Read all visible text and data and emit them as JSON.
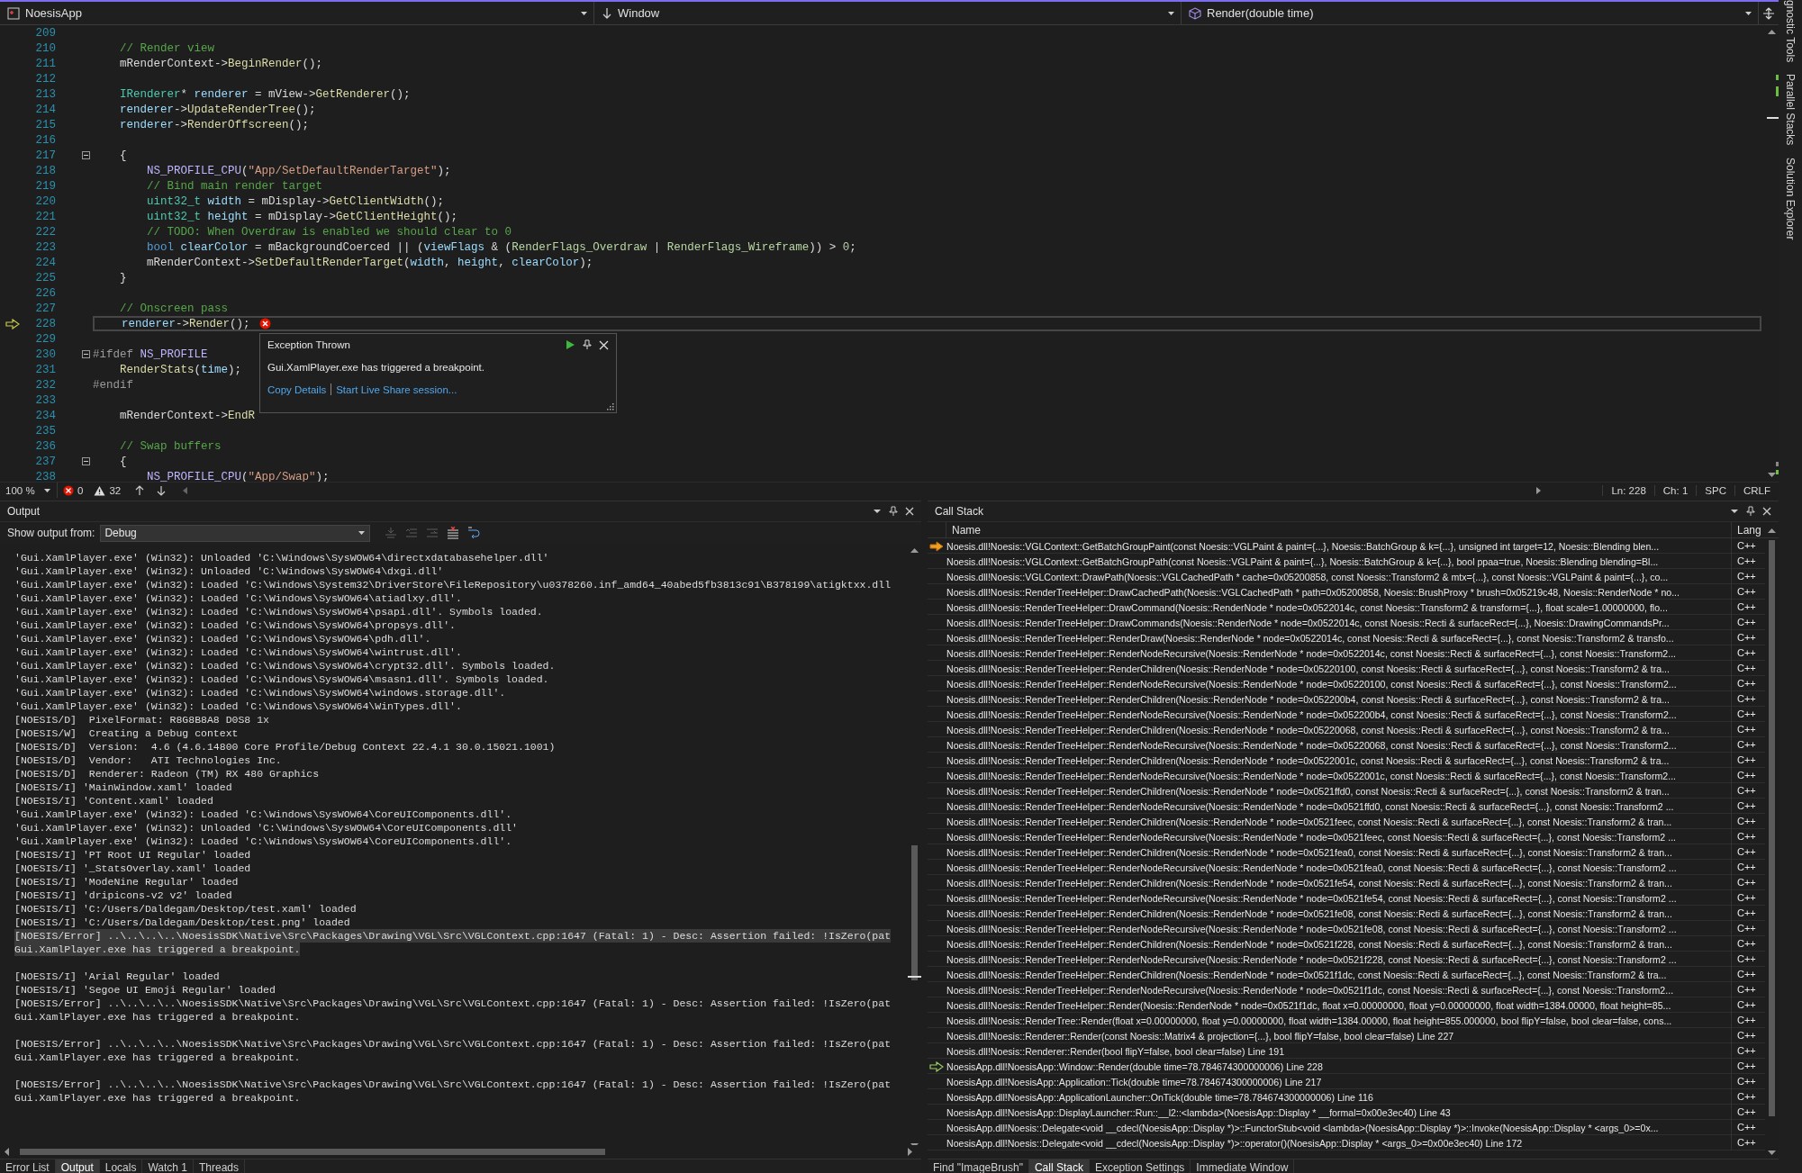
{
  "navigation_bar": [
    {
      "kind": "project",
      "label": "NoesisApp"
    },
    {
      "kind": "scope",
      "label": "Window"
    },
    {
      "kind": "member",
      "label": "Render(double time)"
    }
  ],
  "editor": {
    "lines": [
      {
        "number": "209",
        "current": false
      },
      {
        "number": "210",
        "current": false,
        "code": [
          {
            "kind": "comment",
            "text": "    // Render view"
          }
        ]
      },
      {
        "number": "211",
        "current": false,
        "code": [
          {
            "kind": "plain",
            "text": "    mRenderContext->"
          },
          {
            "kind": "func",
            "text": "BeginRender"
          },
          {
            "kind": "plain",
            "text": "();"
          }
        ]
      },
      {
        "number": "212",
        "current": false
      },
      {
        "number": "213",
        "current": false,
        "code": [
          {
            "kind": "type",
            "text": "    IRenderer"
          },
          {
            "kind": "plain",
            "text": "* "
          },
          {
            "kind": "var",
            "text": "renderer"
          },
          {
            "kind": "plain",
            "text": " = mView->"
          },
          {
            "kind": "func",
            "text": "GetRenderer"
          },
          {
            "kind": "plain",
            "text": "();"
          }
        ]
      },
      {
        "number": "214",
        "current": false,
        "code": [
          {
            "kind": "var",
            "text": "    renderer"
          },
          {
            "kind": "plain",
            "text": "->"
          },
          {
            "kind": "func",
            "text": "UpdateRenderTree"
          },
          {
            "kind": "plain",
            "text": "();"
          }
        ]
      },
      {
        "number": "215",
        "current": false,
        "code": [
          {
            "kind": "var",
            "text": "    renderer"
          },
          {
            "kind": "plain",
            "text": "->"
          },
          {
            "kind": "func",
            "text": "RenderOffscreen"
          },
          {
            "kind": "plain",
            "text": "();"
          }
        ]
      },
      {
        "number": "216",
        "current": false
      },
      {
        "number": "217",
        "current": false,
        "expanded": true,
        "code": [
          {
            "kind": "plain",
            "text": "    {"
          }
        ]
      },
      {
        "number": "218",
        "current": false,
        "code": [
          {
            "kind": "macro",
            "text": "        NS_PROFILE_CPU"
          },
          {
            "kind": "plain",
            "text": "("
          },
          {
            "kind": "string",
            "text": "\"App/SetDefaultRenderTarget\""
          },
          {
            "kind": "plain",
            "text": ");"
          }
        ]
      },
      {
        "number": "219",
        "current": false,
        "code": [
          {
            "kind": "comment",
            "text": "        // Bind main render target"
          }
        ]
      },
      {
        "number": "220",
        "current": false,
        "code": [
          {
            "kind": "type",
            "text": "        uint32_t "
          },
          {
            "kind": "var",
            "text": "width"
          },
          {
            "kind": "plain",
            "text": " = mDisplay->"
          },
          {
            "kind": "func",
            "text": "GetClientWidth"
          },
          {
            "kind": "plain",
            "text": "();"
          }
        ]
      },
      {
        "number": "221",
        "current": false,
        "code": [
          {
            "kind": "type",
            "text": "        uint32_t "
          },
          {
            "kind": "var",
            "text": "height"
          },
          {
            "kind": "plain",
            "text": " = mDisplay->"
          },
          {
            "kind": "func",
            "text": "GetClientHeight"
          },
          {
            "kind": "plain",
            "text": "();"
          }
        ]
      },
      {
        "number": "222",
        "current": false,
        "code": [
          {
            "kind": "comment",
            "text": "        // TODO: When Overdraw is enabled we should clear to 0"
          }
        ]
      },
      {
        "number": "223",
        "current": false,
        "code": [
          {
            "kind": "keyword",
            "text": "        bool "
          },
          {
            "kind": "var",
            "text": "clearColor"
          },
          {
            "kind": "plain",
            "text": " = mBackgroundCoerced || ("
          },
          {
            "kind": "var",
            "text": "viewFlags"
          },
          {
            "kind": "plain",
            "text": " & ("
          },
          {
            "kind": "enum",
            "text": "RenderFlags_Overdraw"
          },
          {
            "kind": "plain",
            "text": " | "
          },
          {
            "kind": "enum",
            "text": "RenderFlags_Wireframe"
          },
          {
            "kind": "plain",
            "text": ")) > "
          },
          {
            "kind": "number",
            "text": "0"
          },
          {
            "kind": "plain",
            "text": ";"
          }
        ]
      },
      {
        "number": "224",
        "current": false,
        "code": [
          {
            "kind": "plain",
            "text": "        mRenderContext->"
          },
          {
            "kind": "func",
            "text": "SetDefaultRenderTarget"
          },
          {
            "kind": "plain",
            "text": "("
          },
          {
            "kind": "var",
            "text": "width"
          },
          {
            "kind": "plain",
            "text": ", "
          },
          {
            "kind": "var",
            "text": "height"
          },
          {
            "kind": "plain",
            "text": ", "
          },
          {
            "kind": "var",
            "text": "clearColor"
          },
          {
            "kind": "plain",
            "text": ");"
          }
        ]
      },
      {
        "number": "225",
        "current": false,
        "code": [
          {
            "kind": "plain",
            "text": "    }"
          }
        ]
      },
      {
        "number": "226",
        "current": false
      },
      {
        "number": "227",
        "current": false,
        "code": [
          {
            "kind": "comment",
            "text": "    // Onscreen pass"
          }
        ]
      },
      {
        "number": "228",
        "current": true,
        "kind": "error",
        "code": [
          {
            "kind": "var",
            "text": "    renderer"
          },
          {
            "kind": "plain",
            "text": "->"
          },
          {
            "kind": "func",
            "text": "Render"
          },
          {
            "kind": "plain",
            "text": "();"
          }
        ]
      },
      {
        "number": "229",
        "current": false
      },
      {
        "number": "230",
        "current": false,
        "expanded": true,
        "code": [
          {
            "kind": "preproc",
            "text": "#ifdef "
          },
          {
            "kind": "macro",
            "text": "NS_PROFILE"
          }
        ]
      },
      {
        "number": "231",
        "current": false,
        "code": [
          {
            "kind": "func",
            "text": "    RenderStats"
          },
          {
            "kind": "plain",
            "text": "("
          },
          {
            "kind": "var",
            "text": "time"
          },
          {
            "kind": "plain",
            "text": ");"
          }
        ]
      },
      {
        "number": "232",
        "current": false,
        "code": [
          {
            "kind": "preproc",
            "text": "#endif"
          }
        ]
      },
      {
        "number": "233",
        "current": false
      },
      {
        "number": "234",
        "current": false,
        "code": [
          {
            "kind": "plain",
            "text": "    mRenderContext->"
          },
          {
            "kind": "func",
            "text": "EndR"
          }
        ]
      },
      {
        "number": "235",
        "current": false
      },
      {
        "number": "236",
        "current": false,
        "code": [
          {
            "kind": "comment",
            "text": "    // Swap buffers"
          }
        ]
      },
      {
        "number": "237",
        "current": false,
        "expanded": true,
        "code": [
          {
            "kind": "plain",
            "text": "    {"
          }
        ]
      },
      {
        "number": "238",
        "current": false,
        "code": [
          {
            "kind": "macro",
            "text": "        NS_PROFILE_CPU"
          },
          {
            "kind": "plain",
            "text": "("
          },
          {
            "kind": "string",
            "text": "\"App/Swap\""
          },
          {
            "kind": "plain",
            "text": ");"
          }
        ]
      }
    ],
    "exception_popup": {
      "title": "Exception Thrown",
      "message": "Gui.XamlPlayer.exe has triggered a breakpoint.",
      "links": [
        "Copy Details",
        "Start Live Share session..."
      ]
    },
    "status": {
      "zoom": "100 %",
      "errors": "0",
      "warnings": "32",
      "line": "Ln: 228",
      "column": "Ch: 1",
      "whitespace": "SPC",
      "line_ending": "CRLF"
    }
  },
  "output": {
    "title": "Output",
    "source_label": "Show output from:",
    "source": "Debug",
    "toolbar": [
      {
        "kind": "find",
        "disabled": true
      },
      {
        "kind": "prev",
        "disabled": true
      },
      {
        "kind": "next",
        "disabled": true
      },
      {
        "kind": "clear",
        "disabled": false
      },
      {
        "kind": "wrap",
        "disabled": false
      }
    ],
    "lines": [
      {
        "text": "'Gui.XamlPlayer.exe' (Win32): Unloaded 'C:\\Windows\\SysWOW64\\directxdatabasehelper.dll'",
        "selected": false
      },
      {
        "text": "'Gui.XamlPlayer.exe' (Win32): Unloaded 'C:\\Windows\\SysWOW64\\dxgi.dll'",
        "selected": false
      },
      {
        "text": "'Gui.XamlPlayer.exe' (Win32): Loaded 'C:\\Windows\\System32\\DriverStore\\FileRepository\\u0378260.inf_amd64_40abed5fb3813c91\\B378199\\atigktxx.dll",
        "selected": false
      },
      {
        "text": "'Gui.XamlPlayer.exe' (Win32): Loaded 'C:\\Windows\\SysWOW64\\atiadlxy.dll'.",
        "selected": false
      },
      {
        "text": "'Gui.XamlPlayer.exe' (Win32): Loaded 'C:\\Windows\\SysWOW64\\psapi.dll'. Symbols loaded.",
        "selected": false
      },
      {
        "text": "'Gui.XamlPlayer.exe' (Win32): Loaded 'C:\\Windows\\SysWOW64\\propsys.dll'.",
        "selected": false
      },
      {
        "text": "'Gui.XamlPlayer.exe' (Win32): Loaded 'C:\\Windows\\SysWOW64\\pdh.dll'.",
        "selected": false
      },
      {
        "text": "'Gui.XamlPlayer.exe' (Win32): Loaded 'C:\\Windows\\SysWOW64\\wintrust.dll'.",
        "selected": false
      },
      {
        "text": "'Gui.XamlPlayer.exe' (Win32): Loaded 'C:\\Windows\\SysWOW64\\crypt32.dll'. Symbols loaded.",
        "selected": false
      },
      {
        "text": "'Gui.XamlPlayer.exe' (Win32): Loaded 'C:\\Windows\\SysWOW64\\msasn1.dll'. Symbols loaded.",
        "selected": false
      },
      {
        "text": "'Gui.XamlPlayer.exe' (Win32): Loaded 'C:\\Windows\\SysWOW64\\windows.storage.dll'.",
        "selected": false
      },
      {
        "text": "'Gui.XamlPlayer.exe' (Win32): Loaded 'C:\\Windows\\SysWOW64\\WinTypes.dll'.",
        "selected": false
      },
      {
        "text": "[NOESIS/D]  PixelFormat: R8G8B8A8 D0S8 1x",
        "selected": false
      },
      {
        "text": "[NOESIS/W]  Creating a Debug context",
        "selected": false
      },
      {
        "text": "[NOESIS/D]  Version:  4.6 (4.6.14800 Core Profile/Debug Context 22.4.1 30.0.15021.1001)",
        "selected": false
      },
      {
        "text": "[NOESIS/D]  Vendor:   ATI Technologies Inc.",
        "selected": false
      },
      {
        "text": "[NOESIS/D]  Renderer: Radeon (TM) RX 480 Graphics",
        "selected": false
      },
      {
        "text": "[NOESIS/I] 'MainWindow.xaml' loaded",
        "selected": false
      },
      {
        "text": "[NOESIS/I] 'Content.xaml' loaded",
        "selected": false
      },
      {
        "text": "'Gui.XamlPlayer.exe' (Win32): Loaded 'C:\\Windows\\SysWOW64\\CoreUIComponents.dll'.",
        "selected": false
      },
      {
        "text": "'Gui.XamlPlayer.exe' (Win32): Unloaded 'C:\\Windows\\SysWOW64\\CoreUIComponents.dll'",
        "selected": false
      },
      {
        "text": "'Gui.XamlPlayer.exe' (Win32): Loaded 'C:\\Windows\\SysWOW64\\CoreUIComponents.dll'.",
        "selected": false
      },
      {
        "text": "[NOESIS/I] 'PT Root UI Regular' loaded",
        "selected": false
      },
      {
        "text": "[NOESIS/I] '_StatsOverlay.xaml' loaded",
        "selected": false
      },
      {
        "text": "[NOESIS/I] 'ModeNine Regular' loaded",
        "selected": false
      },
      {
        "text": "[NOESIS/I] 'dripicons-v2 v2' loaded",
        "selected": false
      },
      {
        "text": "[NOESIS/I] 'C:/Users/Daldegam/Desktop/test.xaml' loaded",
        "selected": false
      },
      {
        "text": "[NOESIS/I] 'C:/Users/Daldegam/Desktop/test.png' loaded",
        "selected": false
      },
      {
        "text": "[NOESIS/Error] ..\\..\\..\\..\\NoesisSDK\\Native\\Src\\Packages\\Drawing\\VGL\\Src\\VGLContext.cpp:1647 (Fatal: 1) - Desc: Assertion failed: !IsZero(pat",
        "selected": true
      },
      {
        "text": "Gui.XamlPlayer.exe has triggered a breakpoint.",
        "selected": true
      },
      {
        "kind": "blank",
        "selected": false
      },
      {
        "text": "[NOESIS/I] 'Arial Regular' loaded",
        "selected": false
      },
      {
        "text": "[NOESIS/I] 'Segoe UI Emoji Regular' loaded",
        "selected": false
      },
      {
        "text": "[NOESIS/Error] ..\\..\\..\\..\\NoesisSDK\\Native\\Src\\Packages\\Drawing\\VGL\\Src\\VGLContext.cpp:1647 (Fatal: 1) - Desc: Assertion failed: !IsZero(pat",
        "selected": false
      },
      {
        "text": "Gui.XamlPlayer.exe has triggered a breakpoint.",
        "selected": false
      },
      {
        "kind": "blank",
        "selected": false
      },
      {
        "text": "[NOESIS/Error] ..\\..\\..\\..\\NoesisSDK\\Native\\Src\\Packages\\Drawing\\VGL\\Src\\VGLContext.cpp:1647 (Fatal: 1) - Desc: Assertion failed: !IsZero(pat",
        "selected": false
      },
      {
        "text": "Gui.XamlPlayer.exe has triggered a breakpoint.",
        "selected": false
      },
      {
        "kind": "blank",
        "selected": false
      },
      {
        "text": "[NOESIS/Error] ..\\..\\..\\..\\NoesisSDK\\Native\\Src\\Packages\\Drawing\\VGL\\Src\\VGLContext.cpp:1647 (Fatal: 1) - Desc: Assertion failed: !IsZero(pat",
        "selected": false
      },
      {
        "text": "Gui.XamlPlayer.exe has triggered a breakpoint.",
        "selected": false
      }
    ],
    "tabs": [
      {
        "label": "Error List",
        "selected": false
      },
      {
        "label": "Output",
        "selected": true
      },
      {
        "label": "Locals",
        "selected": false
      },
      {
        "label": "Watch 1",
        "selected": false
      },
      {
        "label": "Threads",
        "selected": false
      }
    ]
  },
  "call_stack": {
    "title": "Call Stack",
    "columns": [
      "Name",
      "Lang"
    ],
    "rows": [
      {
        "name": "Noesis.dll!Noesis::VGLContext::GetBatchGroupPaint(const Noesis::VGLPaint & paint={...}, Noesis::BatchGroup & k={...}, unsigned int target=12, Noesis::Blending blen...",
        "lang": "C++",
        "kind": "current"
      },
      {
        "name": "Noesis.dll!Noesis::VGLContext::GetBatchGroupPath(const Noesis::VGLPaint & paint={...}, Noesis::BatchGroup & k={...}, bool ppaa=true, Noesis::Blending blending=Bl...",
        "lang": "C++"
      },
      {
        "name": "Noesis.dll!Noesis::VGLContext::DrawPath(Noesis::VGLCachedPath * cache=0x05200858, const Noesis::Transform2 & mtx={...}, const Noesis::VGLPaint & paint={...}, co...",
        "lang": "C++"
      },
      {
        "name": "Noesis.dll!Noesis::RenderTreeHelper::DrawCachedPath(Noesis::VGLCachedPath * path=0x05200858, Noesis::BrushProxy * brush=0x05219c48, Noesis::RenderNode * no...",
        "lang": "C++"
      },
      {
        "name": "Noesis.dll!Noesis::RenderTreeHelper::DrawCommand(Noesis::RenderNode * node=0x0522014c, const Noesis::Transform2 & transform={...}, float scale=1.00000000, flo...",
        "lang": "C++"
      },
      {
        "name": "Noesis.dll!Noesis::RenderTreeHelper::DrawCommands(Noesis::RenderNode * node=0x0522014c, const Noesis::Recti & surfaceRect={...}, Noesis::DrawingCommandsPr...",
        "lang": "C++"
      },
      {
        "name": "Noesis.dll!Noesis::RenderTreeHelper::RenderDraw(Noesis::RenderNode * node=0x0522014c, const Noesis::Recti & surfaceRect={...}, const Noesis::Transform2 & transfo...",
        "lang": "C++"
      },
      {
        "name": "Noesis.dll!Noesis::RenderTreeHelper::RenderNodeRecursive(Noesis::RenderNode * node=0x0522014c, const Noesis::Recti & surfaceRect={...}, const Noesis::Transform2...",
        "lang": "C++"
      },
      {
        "name": "Noesis.dll!Noesis::RenderTreeHelper::RenderChildren(Noesis::RenderNode * node=0x05220100, const Noesis::Recti & surfaceRect={...}, const Noesis::Transform2 & tra...",
        "lang": "C++"
      },
      {
        "name": "Noesis.dll!Noesis::RenderTreeHelper::RenderNodeRecursive(Noesis::RenderNode * node=0x05220100, const Noesis::Recti & surfaceRect={...}, const Noesis::Transform2...",
        "lang": "C++"
      },
      {
        "name": "Noesis.dll!Noesis::RenderTreeHelper::RenderChildren(Noesis::RenderNode * node=0x052200b4, const Noesis::Recti & surfaceRect={...}, const Noesis::Transform2 & tra...",
        "lang": "C++"
      },
      {
        "name": "Noesis.dll!Noesis::RenderTreeHelper::RenderNodeRecursive(Noesis::RenderNode * node=0x052200b4, const Noesis::Recti & surfaceRect={...}, const Noesis::Transform2...",
        "lang": "C++"
      },
      {
        "name": "Noesis.dll!Noesis::RenderTreeHelper::RenderChildren(Noesis::RenderNode * node=0x05220068, const Noesis::Recti & surfaceRect={...}, const Noesis::Transform2 & tra...",
        "lang": "C++"
      },
      {
        "name": "Noesis.dll!Noesis::RenderTreeHelper::RenderNodeRecursive(Noesis::RenderNode * node=0x05220068, const Noesis::Recti & surfaceRect={...}, const Noesis::Transform2...",
        "lang": "C++"
      },
      {
        "name": "Noesis.dll!Noesis::RenderTreeHelper::RenderChildren(Noesis::RenderNode * node=0x0522001c, const Noesis::Recti & surfaceRect={...}, const Noesis::Transform2 & tra...",
        "lang": "C++"
      },
      {
        "name": "Noesis.dll!Noesis::RenderTreeHelper::RenderNodeRecursive(Noesis::RenderNode * node=0x0522001c, const Noesis::Recti & surfaceRect={...}, const Noesis::Transform2...",
        "lang": "C++"
      },
      {
        "name": "Noesis.dll!Noesis::RenderTreeHelper::RenderChildren(Noesis::RenderNode * node=0x0521ffd0, const Noesis::Recti & surfaceRect={...}, const Noesis::Transform2 & tran...",
        "lang": "C++"
      },
      {
        "name": "Noesis.dll!Noesis::RenderTreeHelper::RenderNodeRecursive(Noesis::RenderNode * node=0x0521ffd0, const Noesis::Recti & surfaceRect={...}, const Noesis::Transform2 ...",
        "lang": "C++"
      },
      {
        "name": "Noesis.dll!Noesis::RenderTreeHelper::RenderChildren(Noesis::RenderNode * node=0x0521feec, const Noesis::Recti & surfaceRect={...}, const Noesis::Transform2 & tran...",
        "lang": "C++"
      },
      {
        "name": "Noesis.dll!Noesis::RenderTreeHelper::RenderNodeRecursive(Noesis::RenderNode * node=0x0521feec, const Noesis::Recti & surfaceRect={...}, const Noesis::Transform2 ...",
        "lang": "C++"
      },
      {
        "name": "Noesis.dll!Noesis::RenderTreeHelper::RenderChildren(Noesis::RenderNode * node=0x0521fea0, const Noesis::Recti & surfaceRect={...}, const Noesis::Transform2 & tran...",
        "lang": "C++"
      },
      {
        "name": "Noesis.dll!Noesis::RenderTreeHelper::RenderNodeRecursive(Noesis::RenderNode * node=0x0521fea0, const Noesis::Recti & surfaceRect={...}, const Noesis::Transform2 ...",
        "lang": "C++"
      },
      {
        "name": "Noesis.dll!Noesis::RenderTreeHelper::RenderChildren(Noesis::RenderNode * node=0x0521fe54, const Noesis::Recti & surfaceRect={...}, const Noesis::Transform2 & tran...",
        "lang": "C++"
      },
      {
        "name": "Noesis.dll!Noesis::RenderTreeHelper::RenderNodeRecursive(Noesis::RenderNode * node=0x0521fe54, const Noesis::Recti & surfaceRect={...}, const Noesis::Transform2 ...",
        "lang": "C++"
      },
      {
        "name": "Noesis.dll!Noesis::RenderTreeHelper::RenderChildren(Noesis::RenderNode * node=0x0521fe08, const Noesis::Recti & surfaceRect={...}, const Noesis::Transform2 & tran...",
        "lang": "C++"
      },
      {
        "name": "Noesis.dll!Noesis::RenderTreeHelper::RenderNodeRecursive(Noesis::RenderNode * node=0x0521fe08, const Noesis::Recti & surfaceRect={...}, const Noesis::Transform2 ...",
        "lang": "C++"
      },
      {
        "name": "Noesis.dll!Noesis::RenderTreeHelper::RenderChildren(Noesis::RenderNode * node=0x0521f228, const Noesis::Recti & surfaceRect={...}, const Noesis::Transform2 & tran...",
        "lang": "C++"
      },
      {
        "name": "Noesis.dll!Noesis::RenderTreeHelper::RenderNodeRecursive(Noesis::RenderNode * node=0x0521f228, const Noesis::Recti & surfaceRect={...}, const Noesis::Transform2 ...",
        "lang": "C++"
      },
      {
        "name": "Noesis.dll!Noesis::RenderTreeHelper::RenderChildren(Noesis::RenderNode * node=0x0521f1dc, const Noesis::Recti & surfaceRect={...}, const Noesis::Transform2 & tra...",
        "lang": "C++"
      },
      {
        "name": "Noesis.dll!Noesis::RenderTreeHelper::RenderNodeRecursive(Noesis::RenderNode * node=0x0521f1dc, const Noesis::Recti & surfaceRect={...}, const Noesis::Transform2...",
        "lang": "C++"
      },
      {
        "name": "Noesis.dll!Noesis::RenderTreeHelper::Render(Noesis::RenderNode * node=0x0521f1dc, float x=0.00000000, float y=0.00000000, float width=1384.00000, float height=85...",
        "lang": "C++"
      },
      {
        "name": "Noesis.dll!Noesis::RenderTree::Render(float x=0.00000000, float y=0.00000000, float width=1384.00000, float height=855.000000, bool flipY=false, bool clear=false, cons...",
        "lang": "C++"
      },
      {
        "name": "Noesis.dll!Noesis::Renderer::Render(const Noesis::Matrix4 & projection={...}, bool flipY=false, bool clear=false) Line 227",
        "lang": "C++"
      },
      {
        "name": "Noesis.dll!Noesis::Renderer::Render(bool flipY=false, bool clear=false) Line 191",
        "lang": "C++"
      },
      {
        "name": "NoesisApp.dll!NoesisApp::Window::Render(double time=78.784674300000006) Line 228",
        "lang": "C++",
        "kind": "return"
      },
      {
        "name": "NoesisApp.dll!NoesisApp::Application::Tick(double time=78.784674300000006) Line 217",
        "lang": "C++"
      },
      {
        "name": "NoesisApp.dll!NoesisApp::ApplicationLauncher::OnTick(double time=78.784674300000006) Line 116",
        "lang": "C++"
      },
      {
        "name": "NoesisApp.dll!NoesisApp::DisplayLauncher::Run::__l2::<lambda>(NoesisApp::Display * __formal=0x00e3ec40) Line 43",
        "lang": "C++"
      },
      {
        "name": "NoesisApp.dll!Noesis::Delegate<void __cdecl(NoesisApp::Display *)>::FunctorStub<void <lambda>(NoesisApp::Display *)>::Invoke(NoesisApp::Display * <args_0>=0x...",
        "lang": "C++"
      },
      {
        "name": "NoesisApp.dll!Noesis::Delegate<void __cdecl(NoesisApp::Display *)>::operator()(NoesisApp::Display * <args_0>=0x00e3ec40) Line 172",
        "lang": "C++"
      }
    ],
    "tabs": [
      {
        "label": "Find \"ImageBrush\"",
        "selected": false
      },
      {
        "label": "Call Stack",
        "selected": true
      },
      {
        "label": "Exception Settings",
        "selected": false
      },
      {
        "label": "Immediate Window",
        "selected": false
      }
    ]
  },
  "side_tabs": [
    "gnostic Tools",
    "Parallel Stacks",
    "Solution Explorer"
  ]
}
